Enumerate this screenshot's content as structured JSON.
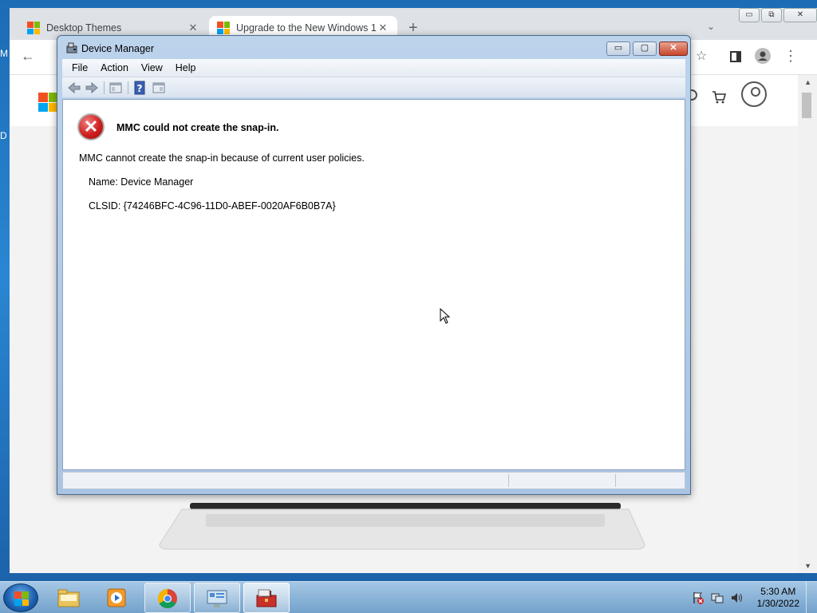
{
  "desktop": {
    "left_letters": [
      "M",
      "D"
    ]
  },
  "browser": {
    "tabs": [
      {
        "title": "Desktop Themes",
        "active": false
      },
      {
        "title": "Upgrade to the New Windows 1",
        "active": true
      }
    ],
    "window_controls": {
      "minimize": "▭",
      "restore": "⧉",
      "close": "✕"
    }
  },
  "mmc": {
    "title": "Device Manager",
    "controls": {
      "minimize": "▭",
      "maximize": "▢",
      "close": "✕"
    },
    "menu": [
      "File",
      "Action",
      "View",
      "Help"
    ],
    "error": {
      "title": "MMC could not create the snap-in.",
      "message": "MMC cannot create the snap-in because of current user policies.",
      "name": "Name: Device Manager",
      "clsid": "CLSID: {74246BFC-4C96-11D0-ABEF-0020AF6B0B7A}"
    }
  },
  "taskbar": {
    "items": [
      "start-button",
      "file-explorer",
      "media-player",
      "chrome",
      "control-panel",
      "mmc-toolbox"
    ],
    "clock": {
      "time": "5:30 AM",
      "date": "1/30/2022"
    }
  },
  "colors": {
    "error_red": "#d02020",
    "taskbar": "#8fb8dd",
    "mmc_frame": "#a9c4e3"
  }
}
